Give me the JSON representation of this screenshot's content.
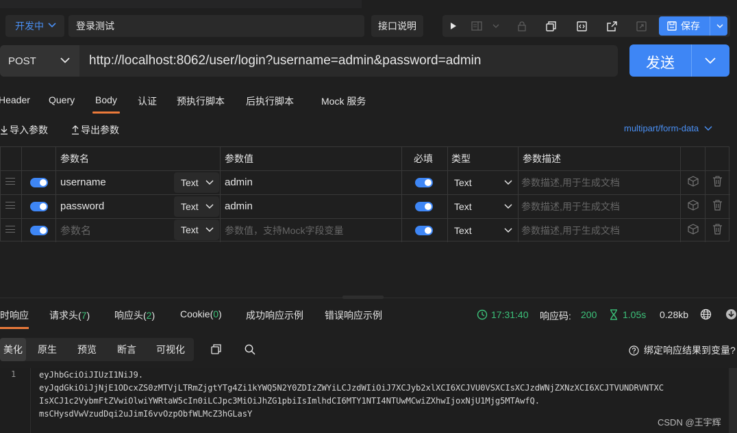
{
  "header": {
    "status": "开发中",
    "api_name": "登录测试",
    "doc_button": "接口说明",
    "save_label": "保存"
  },
  "request": {
    "method": "POST",
    "url": "http://localhost:8062/user/login?username=admin&password=admin",
    "send_label": "发送"
  },
  "request_tabs": [
    "Header",
    "Query",
    "Body",
    "认证",
    "预执行脚本",
    "后执行脚本",
    "Mock 服务"
  ],
  "params_bar": {
    "import": "导入参数",
    "export": "导出参数",
    "form_type": "multipart/form-data"
  },
  "table": {
    "headers": [
      "参数名",
      "参数值",
      "必填",
      "类型",
      "参数描述"
    ],
    "rows": [
      {
        "name": "username",
        "text_type": "Text",
        "value": "admin",
        "type": "Text",
        "desc_placeholder": "参数描述,用于生成文档"
      },
      {
        "name": "password",
        "text_type": "Text",
        "value": "admin",
        "type": "Text",
        "desc_placeholder": "参数描述,用于生成文档"
      },
      {
        "name_placeholder": "参数名",
        "text_type": "Text",
        "value_placeholder": "参数值，支持Mock字段变量",
        "type": "Text",
        "desc_placeholder": "参数描述,用于生成文档"
      }
    ]
  },
  "response_tabs": {
    "realtime": "时响应",
    "req_headers": "请求头(",
    "req_headers_count": "7",
    "resp_headers": "响应头(",
    "resp_headers_count": "2",
    "cookie": "Cookie(",
    "cookie_count": "0",
    "close_paren": ")",
    "success_example": "成功响应示例",
    "error_example": "错误响应示例"
  },
  "response_meta": {
    "time": "17:31:40",
    "code_label": "响应码:",
    "code": "200",
    "duration": "1.05s",
    "size": "0.28kb"
  },
  "view_modes": [
    "美化",
    "原生",
    "预览",
    "断言",
    "可视化"
  ],
  "bind_label": "绑定响应结果到变量?",
  "code": {
    "line_number": "1",
    "lines": [
      "eyJhbGciOiJIUzI1NiJ9.",
      "eyJqdGkiOiJjNjE1ODcxZS0zMTVjLTRmZjgtYTg4Zi1kYWQ5N2Y0ZDIzZWYiLCJzdWIiOiJ7XCJyb2xlXCI6XCJVU0VSXCIsXCJzdWNjZXNzXCI6XCJTVUNDRVNTXC",
      "IsXCJ1c2VybmFtZVwiOlwiYWRtaW5cIn0iLCJpc3MiOiJhZG1pbiIsImlhdCI6MTY1NTI4NTUwMCwiZXhwIjoxNjU1Mjg5MTAwfQ.",
      "msCHysdVwVzudDqi2uJimI6vvOzpObfWLMcZ3hGLasY"
    ]
  },
  "watermark": "CSDN @王宇辉",
  "colors": {
    "accent": "#3e86f5",
    "active_tab": "#ec7a3a",
    "success": "#3cc27a",
    "background": "#1f1f1f"
  }
}
